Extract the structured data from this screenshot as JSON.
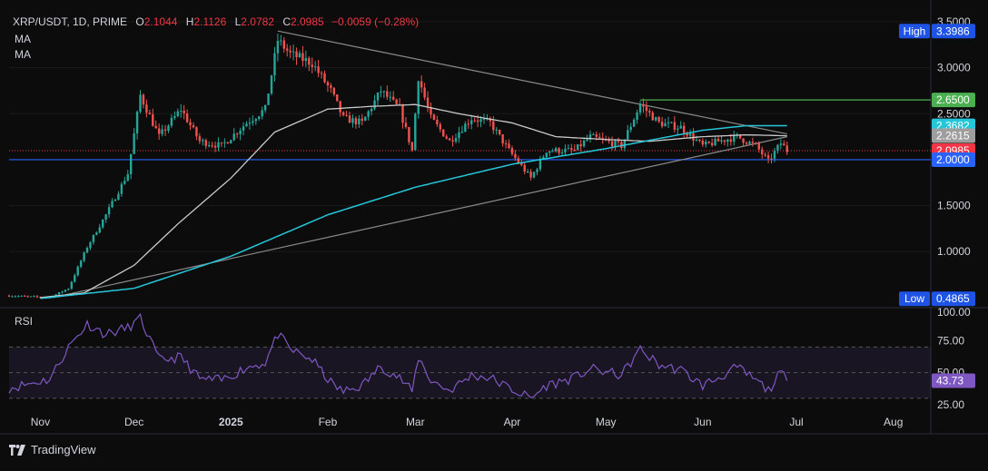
{
  "header": {
    "symbol": "XRP/USDT, 1D, PRIME",
    "open_label": "O",
    "open": "2.1044",
    "high_label": "H",
    "high": "2.1126",
    "low_label": "L",
    "low": "2.0782",
    "close_label": "C",
    "close": "2.0985",
    "change": "−0.0059 (−0.28%)"
  },
  "indicators": {
    "ma1": "MA",
    "ma2": "MA",
    "rsi": "RSI"
  },
  "footer": {
    "brand": "TradingView"
  },
  "colors": {
    "up": "#26a69a",
    "down": "#ef5350",
    "ma_fast": "#c9c9c9",
    "ma_slow": "#26c6da",
    "support": "#2962ff",
    "resistance": "#4caf50",
    "rsi": "#7e57c2",
    "trend": "#8a8a8a"
  },
  "chart_data": {
    "type": "candlestick",
    "price_axis": {
      "ticks": [
        3.5,
        3.0,
        2.5,
        2.0,
        1.5,
        1.0
      ],
      "tick_labels": [
        "3.5000",
        "3.0000",
        "2.5000",
        "2.0000",
        "1.5000",
        "1.0000"
      ],
      "ylim": [
        0.4,
        3.52
      ]
    },
    "time_axis": {
      "labels": [
        "Nov",
        "Dec",
        "2025",
        "Feb",
        "Mar",
        "Apr",
        "May",
        "Jun",
        "Jul",
        "Aug"
      ],
      "dates": [
        "2024-11-01",
        "2024-12-01",
        "2025-01-01",
        "2025-02-01",
        "2025-03-01",
        "2025-04-01",
        "2025-05-01",
        "2025-06-01",
        "2025-07-01",
        "2025-08-01"
      ],
      "range": [
        "2024-10-22",
        "2025-08-13"
      ]
    },
    "price_tags": [
      {
        "label": "High",
        "value": 3.3986,
        "text": "3.3986",
        "color": "#1e53e5"
      },
      {
        "label": "",
        "value": 2.65,
        "text": "2.6500",
        "color": "#4caf50"
      },
      {
        "label": "",
        "value": 2.3682,
        "text": "2.3682",
        "color": "#26c6da"
      },
      {
        "label": "",
        "value": 2.2615,
        "text": "2.2615",
        "color": "#9e9e9e"
      },
      {
        "label": "",
        "value": 2.0985,
        "text": "2.0985",
        "color": "#f23645"
      },
      {
        "label": "",
        "value": 2.0,
        "text": "2.0000",
        "color": "#2962ff"
      },
      {
        "label": "Low",
        "value": 0.4865,
        "text": "0.4865",
        "color": "#1e53e5"
      }
    ],
    "horizontal_lines": [
      {
        "value": 2.0,
        "color": "#2962ff",
        "from": "2024-10-22"
      },
      {
        "value": 2.65,
        "color": "#4caf50",
        "from": "2025-05-12"
      },
      {
        "value": 2.0985,
        "color": "#f23645",
        "dashed": true,
        "from": "2024-10-22"
      }
    ],
    "trendlines": [
      {
        "from": [
          "2025-01-16",
          3.4
        ],
        "to": [
          "2025-06-28",
          2.28
        ]
      },
      {
        "from": [
          "2024-11-05",
          0.5
        ],
        "to": [
          "2025-06-28",
          2.25
        ]
      }
    ],
    "ohlc_keypoints": [
      [
        "2024-10-22",
        0.52
      ],
      [
        "2024-11-04",
        0.5
      ],
      [
        "2024-11-10",
        0.6
      ],
      [
        "2024-11-16",
        1.05
      ],
      [
        "2024-11-22",
        1.4
      ],
      [
        "2024-11-29",
        1.85
      ],
      [
        "2024-12-03",
        2.7
      ],
      [
        "2024-12-09",
        2.25
      ],
      [
        "2024-12-16",
        2.55
      ],
      [
        "2024-12-22",
        2.2
      ],
      [
        "2024-12-29",
        2.15
      ],
      [
        "2025-01-06",
        2.4
      ],
      [
        "2025-01-12",
        2.55
      ],
      [
        "2025-01-16",
        3.3
      ],
      [
        "2025-01-20",
        3.15
      ],
      [
        "2025-01-27",
        3.05
      ],
      [
        "2025-02-02",
        2.75
      ],
      [
        "2025-02-06",
        2.45
      ],
      [
        "2025-02-12",
        2.4
      ],
      [
        "2025-02-18",
        2.75
      ],
      [
        "2025-02-24",
        2.55
      ],
      [
        "2025-02-28",
        2.1
      ],
      [
        "2025-03-02",
        2.9
      ],
      [
        "2025-03-06",
        2.45
      ],
      [
        "2025-03-12",
        2.2
      ],
      [
        "2025-03-19",
        2.45
      ],
      [
        "2025-03-25",
        2.4
      ],
      [
        "2025-03-31",
        2.1
      ],
      [
        "2025-04-07",
        1.8
      ],
      [
        "2025-04-12",
        2.1
      ],
      [
        "2025-04-21",
        2.1
      ],
      [
        "2025-04-26",
        2.25
      ],
      [
        "2025-05-06",
        2.15
      ],
      [
        "2025-05-12",
        2.6
      ],
      [
        "2025-05-18",
        2.4
      ],
      [
        "2025-05-25",
        2.35
      ],
      [
        "2025-06-01",
        2.15
      ],
      [
        "2025-06-06",
        2.2
      ],
      [
        "2025-06-12",
        2.25
      ],
      [
        "2025-06-18",
        2.15
      ],
      [
        "2025-06-22",
        1.98
      ],
      [
        "2025-06-26",
        2.18
      ],
      [
        "2025-06-28",
        2.0985
      ]
    ],
    "ma_fast": [
      [
        "2024-11-01",
        0.5
      ],
      [
        "2024-11-15",
        0.55
      ],
      [
        "2024-12-01",
        0.85
      ],
      [
        "2024-12-15",
        1.3
      ],
      [
        "2025-01-01",
        1.8
      ],
      [
        "2025-01-15",
        2.3
      ],
      [
        "2025-02-01",
        2.55
      ],
      [
        "2025-02-15",
        2.58
      ],
      [
        "2025-03-01",
        2.6
      ],
      [
        "2025-03-15",
        2.5
      ],
      [
        "2025-04-01",
        2.4
      ],
      [
        "2025-04-15",
        2.25
      ],
      [
        "2025-05-01",
        2.22
      ],
      [
        "2025-05-15",
        2.2
      ],
      [
        "2025-06-01",
        2.25
      ],
      [
        "2025-06-15",
        2.27
      ],
      [
        "2025-06-28",
        2.26
      ]
    ],
    "ma_slow": [
      [
        "2024-11-01",
        0.49
      ],
      [
        "2024-12-01",
        0.6
      ],
      [
        "2025-01-01",
        0.95
      ],
      [
        "2025-02-01",
        1.4
      ],
      [
        "2025-03-01",
        1.7
      ],
      [
        "2025-04-01",
        1.95
      ],
      [
        "2025-05-01",
        2.12
      ],
      [
        "2025-06-01",
        2.32
      ],
      [
        "2025-06-15",
        2.37
      ],
      [
        "2025-06-28",
        2.37
      ]
    ],
    "rsi": {
      "label": "RSI",
      "value": 43.73,
      "value_text": "43.73",
      "ticks": [
        100,
        75,
        50,
        25
      ],
      "tick_labels": [
        "100.00",
        "75.00",
        "50.00",
        "25.00"
      ],
      "band": [
        30,
        70
      ],
      "ylim": [
        20,
        100
      ],
      "points": [
        [
          "2024-10-22",
          38
        ],
        [
          "2024-11-04",
          45
        ],
        [
          "2024-11-10",
          70
        ],
        [
          "2024-11-16",
          88
        ],
        [
          "2024-11-22",
          80
        ],
        [
          "2024-11-29",
          85
        ],
        [
          "2024-12-03",
          92
        ],
        [
          "2024-12-09",
          60
        ],
        [
          "2024-12-16",
          62
        ],
        [
          "2024-12-22",
          45
        ],
        [
          "2024-12-29",
          44
        ],
        [
          "2025-01-06",
          54
        ],
        [
          "2025-01-12",
          58
        ],
        [
          "2025-01-16",
          80
        ],
        [
          "2025-01-20",
          68
        ],
        [
          "2025-01-27",
          60
        ],
        [
          "2025-02-02",
          42
        ],
        [
          "2025-02-06",
          35
        ],
        [
          "2025-02-12",
          40
        ],
        [
          "2025-02-18",
          55
        ],
        [
          "2025-02-24",
          46
        ],
        [
          "2025-02-28",
          35
        ],
        [
          "2025-03-02",
          62
        ],
        [
          "2025-03-06",
          44
        ],
        [
          "2025-03-12",
          36
        ],
        [
          "2025-03-19",
          48
        ],
        [
          "2025-03-25",
          46
        ],
        [
          "2025-03-31",
          38
        ],
        [
          "2025-04-07",
          30
        ],
        [
          "2025-04-12",
          40
        ],
        [
          "2025-04-21",
          46
        ],
        [
          "2025-04-26",
          53
        ],
        [
          "2025-05-06",
          48
        ],
        [
          "2025-05-12",
          68
        ],
        [
          "2025-05-18",
          56
        ],
        [
          "2025-05-25",
          52
        ],
        [
          "2025-06-01",
          40
        ],
        [
          "2025-06-06",
          46
        ],
        [
          "2025-06-12",
          54
        ],
        [
          "2025-06-18",
          44
        ],
        [
          "2025-06-22",
          36
        ],
        [
          "2025-06-26",
          50
        ],
        [
          "2025-06-28",
          43.73
        ]
      ]
    }
  }
}
